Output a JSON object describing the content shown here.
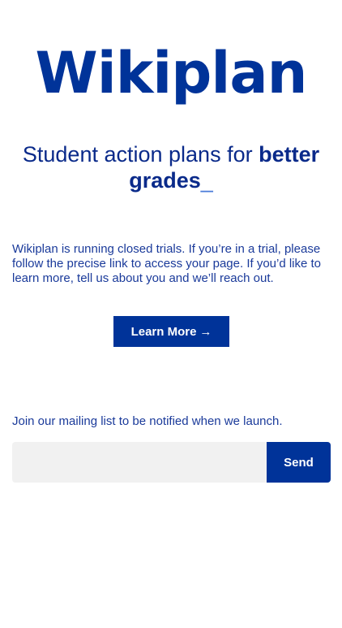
{
  "header": {
    "logo_text": "Wikiplan"
  },
  "hero": {
    "tagline_regular": "Student action plans for ",
    "tagline_bold_1": "better",
    "tagline_bold_2": "grades",
    "tagline_cursor": "_"
  },
  "intro": {
    "text": "Wikiplan is running closed trials. If you’re in a trial, please follow the precise link to access your page. If you’d like to learn more, tell us about you and we’ll reach out."
  },
  "learn_more": {
    "label": "Learn More",
    "arrow": "→"
  },
  "mailing": {
    "text": "Join our mailing list to be notified when we launch.",
    "input_value": "",
    "input_placeholder": "",
    "send_label": "Send"
  },
  "colors": {
    "brand": "#003399",
    "text": "#1a3a9a",
    "input_bg": "#f1f1f1"
  }
}
